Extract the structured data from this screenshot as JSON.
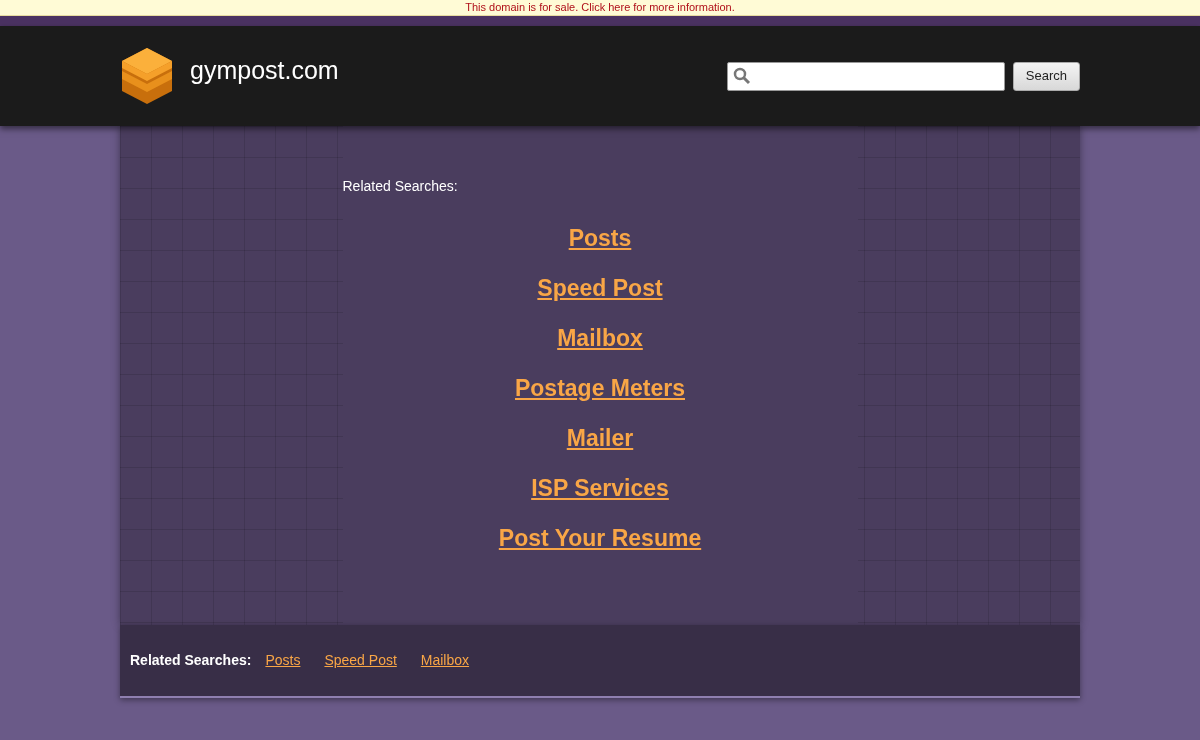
{
  "notice": "This domain is for sale. Click here for more information.",
  "header": {
    "site_name": "gympost.com",
    "search_button": "Search"
  },
  "main": {
    "heading": "Related Searches:",
    "links": [
      "Posts",
      "Speed Post",
      "Mailbox",
      "Postage Meters",
      "Mailer",
      "ISP Services",
      "Post Your Resume"
    ]
  },
  "footer": {
    "label": "Related Searches:",
    "links": [
      "Posts",
      "Speed Post",
      "Mailbox"
    ]
  }
}
